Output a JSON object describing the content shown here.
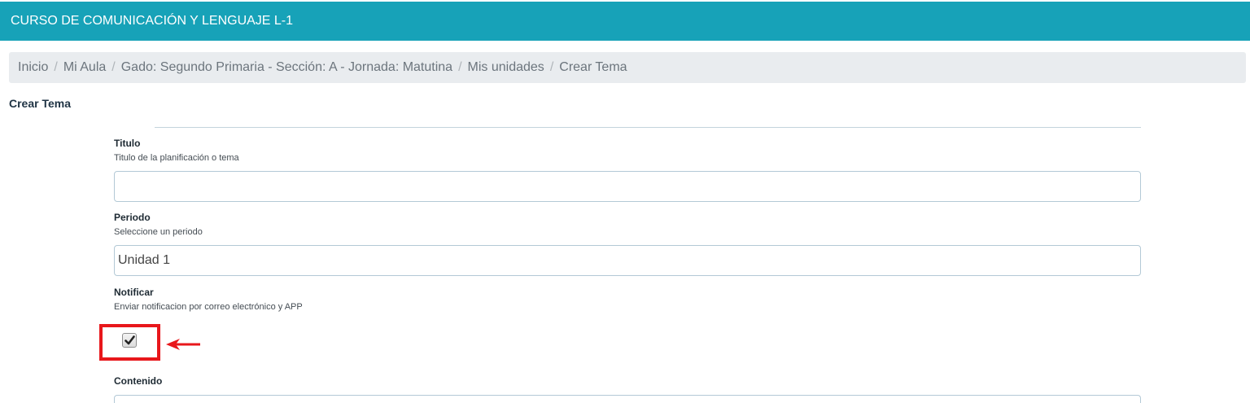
{
  "header": {
    "title": "CURSO DE COMUNICACIÓN Y LENGUAJE L-1"
  },
  "breadcrumb": {
    "items": [
      "Inicio",
      "Mi Aula",
      "Gado: Segundo Primaria - Sección: A - Jornada: Matutina",
      "Mis unidades",
      "Crear Tema"
    ],
    "separator": "/"
  },
  "page": {
    "title": "Crear Tema"
  },
  "form": {
    "titulo": {
      "label": "Titulo",
      "help": "Titulo de la planificación o tema",
      "value": ""
    },
    "periodo": {
      "label": "Periodo",
      "help": "Seleccione un periodo",
      "value": "Unidad 1"
    },
    "notificar": {
      "label": "Notificar",
      "help": "Enviar notificacion por correo electrónico y APP",
      "checked": true
    },
    "contenido": {
      "label": "Contenido"
    }
  },
  "annotation": {
    "color": "#e8171b"
  },
  "colors": {
    "header_bg": "#17a2b8",
    "breadcrumb_bg": "#e9ecef"
  }
}
